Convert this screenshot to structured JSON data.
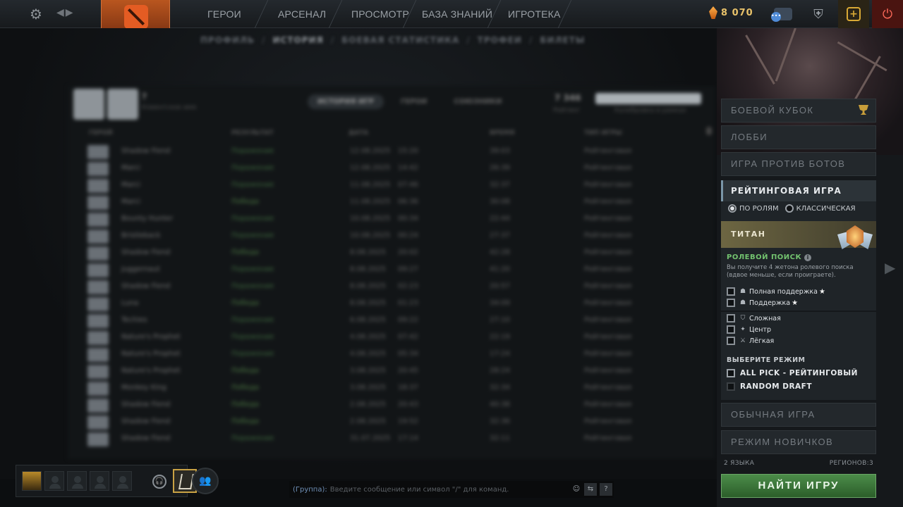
{
  "topbar": {
    "nav": [
      "ГЕРОИ",
      "АРСЕНАЛ",
      "ПРОСМОТР",
      "БАЗА ЗНАНИЙ",
      "ИГРОТЕКА"
    ],
    "shards": "8 070",
    "chat_badge": "•••"
  },
  "subnav": [
    "ПРОФИЛЬ",
    "ИСТОРИЯ",
    "БОЕВАЯ СТАТИСТИКА",
    "ТРОФЕИ",
    "БИЛЕТЫ"
  ],
  "history": {
    "player_name": "?",
    "player_sub": "Клиентское имя",
    "tabs": [
      "ИСТОРИЯ ИГР",
      "ГЕРОИ",
      "СОЮЗНИКИ"
    ],
    "stat_value": "7 346",
    "stat_label": "Рейтинг",
    "bar_label": "MMR",
    "bar_sub": "Калибровка в рамках",
    "headers": [
      "ГЕРОЙ",
      "РЕЗУЛЬТАТ",
      "ДАТА",
      "ВРЕМЯ",
      "ТИП ИГРЫ"
    ],
    "rows": [
      {
        "hero": "Shadow Fiend",
        "result": "Поражение",
        "win": false,
        "date": "12.08.2025",
        "time": "15:20",
        "dur": "39:03",
        "type": "Рейтинговая"
      },
      {
        "hero": "Marci",
        "result": "Поражение",
        "win": false,
        "date": "12.08.2025",
        "time": "14:42",
        "dur": "26:39",
        "type": "Рейтинговая"
      },
      {
        "hero": "Marci",
        "result": "Поражение",
        "win": false,
        "date": "11.08.2025",
        "time": "07:46",
        "dur": "32:37",
        "type": "Рейтинговая"
      },
      {
        "hero": "Marci",
        "result": "Победа",
        "win": true,
        "date": "11.08.2025",
        "time": "06:36",
        "dur": "30:08",
        "type": "Рейтинговая"
      },
      {
        "hero": "Bounty Hunter",
        "result": "Поражение",
        "win": false,
        "date": "10.08.2025",
        "time": "00:34",
        "dur": "22:44",
        "type": "Рейтинговая"
      },
      {
        "hero": "Bristleback",
        "result": "Поражение",
        "win": false,
        "date": "10.08.2025",
        "time": "00:24",
        "dur": "27:37",
        "type": "Рейтинговая"
      },
      {
        "hero": "Shadow Fiend",
        "result": "Победа",
        "win": true,
        "date": "8.08.2025",
        "time": "20:02",
        "dur": "42:28",
        "type": "Рейтинговая"
      },
      {
        "hero": "Juggernaut",
        "result": "Поражение",
        "win": false,
        "date": "8.08.2025",
        "time": "09:27",
        "dur": "41:20",
        "type": "Рейтинговая"
      },
      {
        "hero": "Shadow Fiend",
        "result": "Поражение",
        "win": false,
        "date": "8.08.2025",
        "time": "02:23",
        "dur": "20:57",
        "type": "Рейтинговая"
      },
      {
        "hero": "Luna",
        "result": "Победа",
        "win": true,
        "date": "8.08.2025",
        "time": "01:23",
        "dur": "34:09",
        "type": "Рейтинговая"
      },
      {
        "hero": "Techies",
        "result": "Поражение",
        "win": false,
        "date": "6.08.2025",
        "time": "09:22",
        "dur": "27:10",
        "type": "Рейтинговая"
      },
      {
        "hero": "Nature's Prophet",
        "result": "Поражение",
        "win": false,
        "date": "4.08.2025",
        "time": "07:42",
        "dur": "22:19",
        "type": "Рейтинговая"
      },
      {
        "hero": "Nature's Prophet",
        "result": "Поражение",
        "win": false,
        "date": "4.08.2025",
        "time": "05:34",
        "dur": "17:24",
        "type": "Рейтинговая"
      },
      {
        "hero": "Nature's Prophet",
        "result": "Победа",
        "win": true,
        "date": "3.08.2025",
        "time": "20:45",
        "dur": "28:24",
        "type": "Рейтинговая"
      },
      {
        "hero": "Monkey King",
        "result": "Победа",
        "win": true,
        "date": "3.08.2025",
        "time": "18:37",
        "dur": "32:34",
        "type": "Рейтинговая"
      },
      {
        "hero": "Shadow Fiend",
        "result": "Победа",
        "win": true,
        "date": "2.08.2025",
        "time": "20:43",
        "dur": "40:38",
        "type": "Рейтинговая"
      },
      {
        "hero": "Shadow Fiend",
        "result": "Победа",
        "win": true,
        "date": "2.08.2025",
        "time": "19:52",
        "dur": "32:36",
        "type": "Рейтинговая"
      },
      {
        "hero": "Shadow Fiend",
        "result": "Поражение",
        "win": false,
        "date": "31.07.2025",
        "time": "17:14",
        "dur": "32:11",
        "type": "Рейтинговая"
      }
    ]
  },
  "chat": {
    "group": "(Группа):",
    "placeholder": "Введите сообщение или символ \"/\" для команд."
  },
  "sidebar": {
    "battle_cup": "БОЕВОЙ КУБОК",
    "lobby": "ЛОББИ",
    "bots": "ИГРА ПРОТИВ БОТОВ",
    "ranked": "РЕЙТИНГОВАЯ ИГРА",
    "by_roles": "ПО РОЛЯМ",
    "classic": "КЛАССИЧЕСКАЯ",
    "tier": "ТИТАН",
    "role_search": "РОЛЕВОЙ ПОИСК",
    "role_desc": "Вы получите 4 жетона ролевого поиска (вдвое меньше, если проиграете).",
    "roles": [
      "Полная поддержка",
      "Поддержка",
      "Сложная",
      "Центр",
      "Лёгкая"
    ],
    "choose_mode": "ВЫБЕРИТЕ РЕЖИМ",
    "mode_ap": "ALL PICK - РЕЙТИНГОВЫЙ",
    "mode_rd": "RANDOM DRAFT",
    "normal": "ОБЫЧНАЯ ИГРА",
    "newbie": "РЕЖИМ НОВИЧКОВ",
    "languages": "2 ЯЗЫКА",
    "regions": "РЕГИОНОВ:3",
    "find": "НАЙТИ ИГРУ"
  }
}
